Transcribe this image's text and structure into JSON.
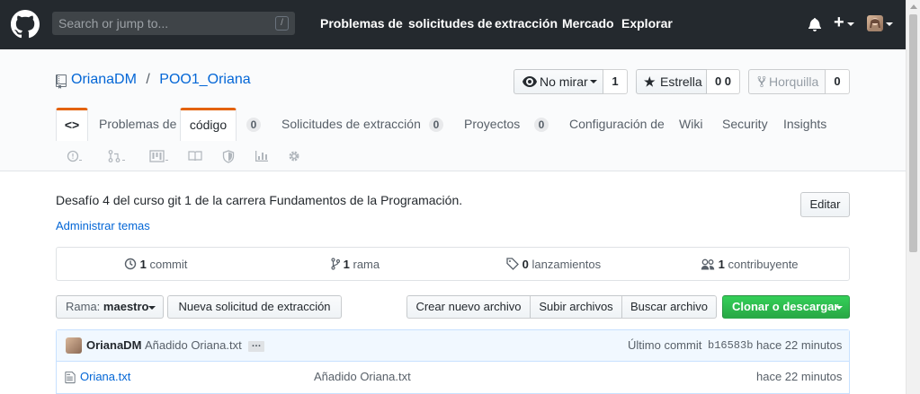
{
  "header": {
    "search_placeholder": "Search or jump to...",
    "search_shortcut": "/",
    "nav": [
      "Problemas de",
      "solicitudes de",
      "extracción",
      "Mercado",
      "Explorar"
    ],
    "plus": "+"
  },
  "repo": {
    "owner": "OrianaDM",
    "separator": "/",
    "name": "POO1_Oriana",
    "watch_label": "No mirar",
    "watch_count": "1",
    "star_label": "Estrella",
    "star_count": "0 0",
    "fork_label": "Horquilla",
    "fork_count": "0"
  },
  "tabs": [
    {
      "label": "<>",
      "count": null
    },
    {
      "label": "Problemas de",
      "count": null
    },
    {
      "label": "código",
      "count": "0"
    },
    {
      "label": "Solicitudes de extracción",
      "count": "0"
    },
    {
      "label": "Proyectos",
      "count": "0"
    },
    {
      "label": "Configuración de",
      "count": null
    },
    {
      "label": "Wiki",
      "count": null
    },
    {
      "label": "Security",
      "count": null
    },
    {
      "label": "Insights",
      "count": null
    }
  ],
  "about": {
    "description": "Desafío 4 del curso git 1 de la carrera Fundamentos de la Programación.",
    "manage_topics": "Administrar temas",
    "edit_label": "Editar"
  },
  "summary": {
    "commits_num": "1",
    "commits_label": "commit",
    "branches_num": "1",
    "branches_label": "rama",
    "releases_num": "0",
    "releases_label": "lanzamientos",
    "contributors_num": "1",
    "contributors_label": "contribuyente"
  },
  "toolbar": {
    "branch_prefix": "Rama:",
    "branch_name": "maestro",
    "new_pr": "Nueva solicitud de extracción",
    "create_file": "Crear nuevo archivo",
    "upload": "Subir archivos",
    "find": "Buscar archivo",
    "clone": "Clonar o descargar"
  },
  "latest_commit": {
    "author": "OrianaDM",
    "message": "Añadido Oriana.txt",
    "ellipsis": "…",
    "label": "Último commit",
    "sha": "b16583b",
    "time": "hace 22 minutos"
  },
  "files": [
    {
      "name": "Oriana.txt",
      "message": "Añadido Oriana.txt",
      "time": "hace 22 minutos"
    }
  ],
  "colors": {
    "header_bg": "#24292e",
    "link": "#0366d6",
    "accent_tab": "#e36209",
    "clone_green": "#28a745"
  }
}
